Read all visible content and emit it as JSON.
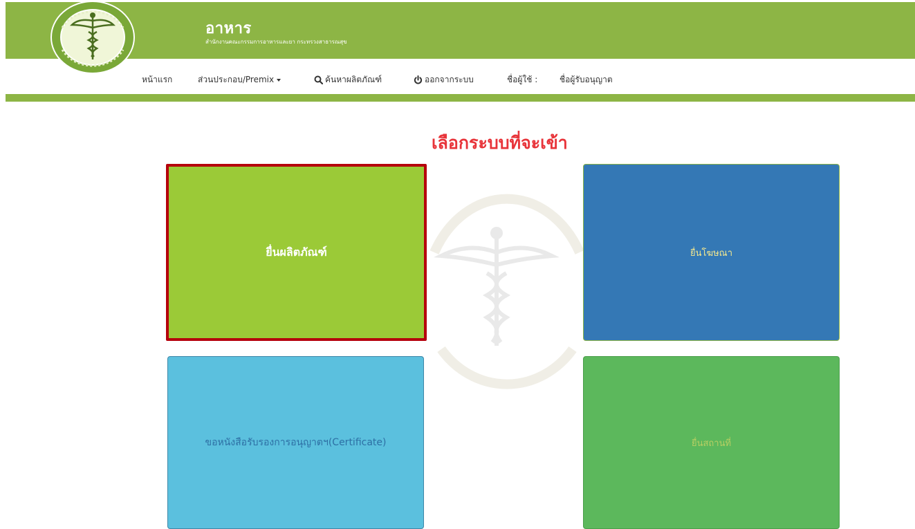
{
  "header": {
    "title": "อาหาร",
    "subtitle": "สำนักงานคณะกรรมการอาหารและยา กระทรวงสาธารณสุข",
    "logo_icon": "caduceus-seal-icon"
  },
  "nav": {
    "home": "หน้าแรก",
    "premix": "ส่วนประกอบ/Premix",
    "search_products": "ค้นหาผลิตภัณฑ์",
    "logout": "ออกจากระบบ",
    "username_label": "ชื่อผู้ใช้ :",
    "licensee_name": "ชื่อผู้รับอนุญาต",
    "icons": {
      "search": "search-icon",
      "logout": "power-icon",
      "premix_dropdown": "caret-down-icon"
    }
  },
  "page": {
    "heading": "เลือกระบบที่จะเข้า"
  },
  "tiles": {
    "submit_product": "ยื่นผลิตภัณฑ์",
    "submit_advertisement": "ยื่นโฆษณา",
    "request_certificate": "ขอหนังสือรับรองการอนุญาตฯ(Certificate)",
    "submit_premises": "ยื่นสถานที่"
  },
  "colors": {
    "header_green": "#8db545",
    "heading_red": "#e8343a",
    "product_tile": "#9bca37",
    "product_tile_border": "#b5000c",
    "advert_tile": "#3478b5",
    "certificate_tile": "#5bc0de",
    "premises_tile": "#5cb85c"
  }
}
